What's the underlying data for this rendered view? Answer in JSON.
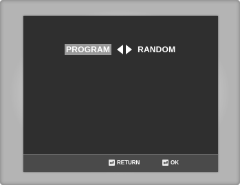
{
  "menu": {
    "selected_option": "PROGRAM",
    "other_option": "RANDOM"
  },
  "footer": {
    "return_label": "RETURN",
    "ok_label": "OK"
  },
  "icons": {
    "left": "left-arrow-icon",
    "right": "right-arrow-icon",
    "return": "return-icon",
    "enter": "enter-icon"
  }
}
